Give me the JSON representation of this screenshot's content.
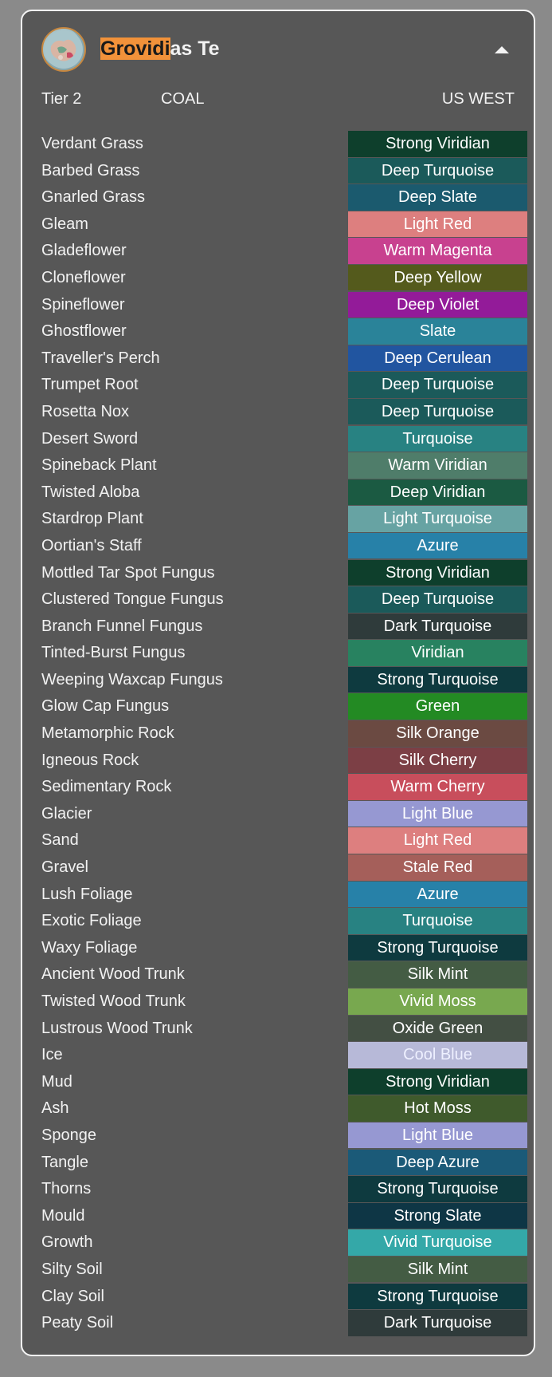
{
  "header": {
    "title_highlight": "Grovidi",
    "title_rest": "as Te",
    "avatar_icon": "globe-map-avatar",
    "collapse_icon": "caret-up-icon"
  },
  "meta": {
    "tier": "Tier 2",
    "material": "COAL",
    "region": "US WEST"
  },
  "rows": [
    {
      "name": "Verdant Grass",
      "color": "Strong Viridian",
      "hex": "#0e3f2c",
      "text": "#ffffff"
    },
    {
      "name": "Barbed Grass",
      "color": "Deep Turquoise",
      "hex": "#1b5a5a",
      "text": "#ffffff"
    },
    {
      "name": "Gnarled Grass",
      "color": "Deep Slate",
      "hex": "#1b5a6e",
      "text": "#ffffff"
    },
    {
      "name": "Gleam",
      "color": "Light Red",
      "hex": "#dd7f7f",
      "text": "#ffffff"
    },
    {
      "name": "Gladeflower",
      "color": "Warm Magenta",
      "hex": "#c8418f",
      "text": "#ffffff"
    },
    {
      "name": "Cloneflower",
      "color": "Deep Yellow",
      "hex": "#545a1c",
      "text": "#ffffff"
    },
    {
      "name": "Spineflower",
      "color": "Deep Violet",
      "hex": "#931b99",
      "text": "#ffffff"
    },
    {
      "name": "Ghostflower",
      "color": "Slate",
      "hex": "#2a8399",
      "text": "#ffffff"
    },
    {
      "name": "Traveller's Perch",
      "color": "Deep Cerulean",
      "hex": "#2155a0",
      "text": "#ffffff"
    },
    {
      "name": "Trumpet Root",
      "color": "Deep Turquoise",
      "hex": "#1b5a5a",
      "text": "#ffffff"
    },
    {
      "name": "Rosetta Nox",
      "color": "Deep Turquoise",
      "hex": "#1b5a5a",
      "text": "#ffffff"
    },
    {
      "name": "Desert Sword",
      "color": "Turquoise",
      "hex": "#288282",
      "text": "#ffffff"
    },
    {
      "name": "Spineback Plant",
      "color": "Warm Viridian",
      "hex": "#4f7d6a",
      "text": "#ffffff"
    },
    {
      "name": "Twisted Aloba",
      "color": "Deep Viridian",
      "hex": "#1b5a42",
      "text": "#ffffff"
    },
    {
      "name": "Stardrop Plant",
      "color": "Light Turquoise",
      "hex": "#67a3a3",
      "text": "#ffffff"
    },
    {
      "name": "Oortian's Staff",
      "color": "Azure",
      "hex": "#2781a8",
      "text": "#ffffff"
    },
    {
      "name": "Mottled Tar Spot Fungus",
      "color": "Strong Viridian",
      "hex": "#0e3f2c",
      "text": "#ffffff"
    },
    {
      "name": "Clustered Tongue Fungus",
      "color": "Deep Turquoise",
      "hex": "#1b5a5a",
      "text": "#ffffff"
    },
    {
      "name": "Branch Funnel Fungus",
      "color": "Dark Turquoise",
      "hex": "#2f3b3b",
      "text": "#ffffff"
    },
    {
      "name": "Tinted-Burst Fungus",
      "color": "Viridian",
      "hex": "#288260",
      "text": "#ffffff"
    },
    {
      "name": "Weeping Waxcap Fungus",
      "color": "Strong Turquoise",
      "hex": "#0e3a3f",
      "text": "#ffffff"
    },
    {
      "name": "Glow Cap Fungus",
      "color": "Green",
      "hex": "#238a23",
      "text": "#ffffff"
    },
    {
      "name": "Metamorphic Rock",
      "color": "Silk Orange",
      "hex": "#6b4a42",
      "text": "#ffffff"
    },
    {
      "name": "Igneous Rock",
      "color": "Silk Cherry",
      "hex": "#7c3f45",
      "text": "#ffffff"
    },
    {
      "name": "Sedimentary Rock",
      "color": "Warm Cherry",
      "hex": "#c84e5c",
      "text": "#ffffff"
    },
    {
      "name": "Glacier",
      "color": "Light Blue",
      "hex": "#9698d2",
      "text": "#ffffff"
    },
    {
      "name": "Sand",
      "color": "Light Red",
      "hex": "#dd7f7f",
      "text": "#ffffff"
    },
    {
      "name": "Gravel",
      "color": "Stale Red",
      "hex": "#a55f5a",
      "text": "#ffffff"
    },
    {
      "name": "Lush Foliage",
      "color": "Azure",
      "hex": "#2781a8",
      "text": "#ffffff"
    },
    {
      "name": "Exotic Foliage",
      "color": "Turquoise",
      "hex": "#288282",
      "text": "#ffffff"
    },
    {
      "name": "Waxy Foliage",
      "color": "Strong Turquoise",
      "hex": "#0e3a3f",
      "text": "#ffffff"
    },
    {
      "name": "Ancient Wood Trunk",
      "color": "Silk Mint",
      "hex": "#445c44",
      "text": "#ffffff"
    },
    {
      "name": "Twisted Wood Trunk",
      "color": "Vivid Moss",
      "hex": "#78a84f",
      "text": "#ffffff"
    },
    {
      "name": "Lustrous Wood Trunk",
      "color": "Oxide Green",
      "hex": "#434f43",
      "text": "#ffffff"
    },
    {
      "name": "Ice",
      "color": "Cool Blue",
      "hex": "#b7b9d8",
      "text": "#eef0ff"
    },
    {
      "name": "Mud",
      "color": "Strong Viridian",
      "hex": "#0e3f2c",
      "text": "#ffffff"
    },
    {
      "name": "Ash",
      "color": "Hot Moss",
      "hex": "#3f5a2c",
      "text": "#ffffff"
    },
    {
      "name": "Sponge",
      "color": "Light Blue",
      "hex": "#9698d2",
      "text": "#ffffff"
    },
    {
      "name": "Tangle",
      "color": "Deep Azure",
      "hex": "#1b5a78",
      "text": "#ffffff"
    },
    {
      "name": "Thorns",
      "color": "Strong Turquoise",
      "hex": "#0e3a3f",
      "text": "#ffffff"
    },
    {
      "name": "Mould",
      "color": "Strong Slate",
      "hex": "#0e3645",
      "text": "#ffffff"
    },
    {
      "name": "Growth",
      "color": "Vivid Turquoise",
      "hex": "#34a8a8",
      "text": "#ffffff"
    },
    {
      "name": "Silty Soil",
      "color": "Silk Mint",
      "hex": "#445c44",
      "text": "#ffffff"
    },
    {
      "name": "Clay Soil",
      "color": "Strong Turquoise",
      "hex": "#0e3a3f",
      "text": "#ffffff"
    },
    {
      "name": "Peaty Soil",
      "color": "Dark Turquoise",
      "hex": "#2f3b3b",
      "text": "#ffffff"
    }
  ]
}
